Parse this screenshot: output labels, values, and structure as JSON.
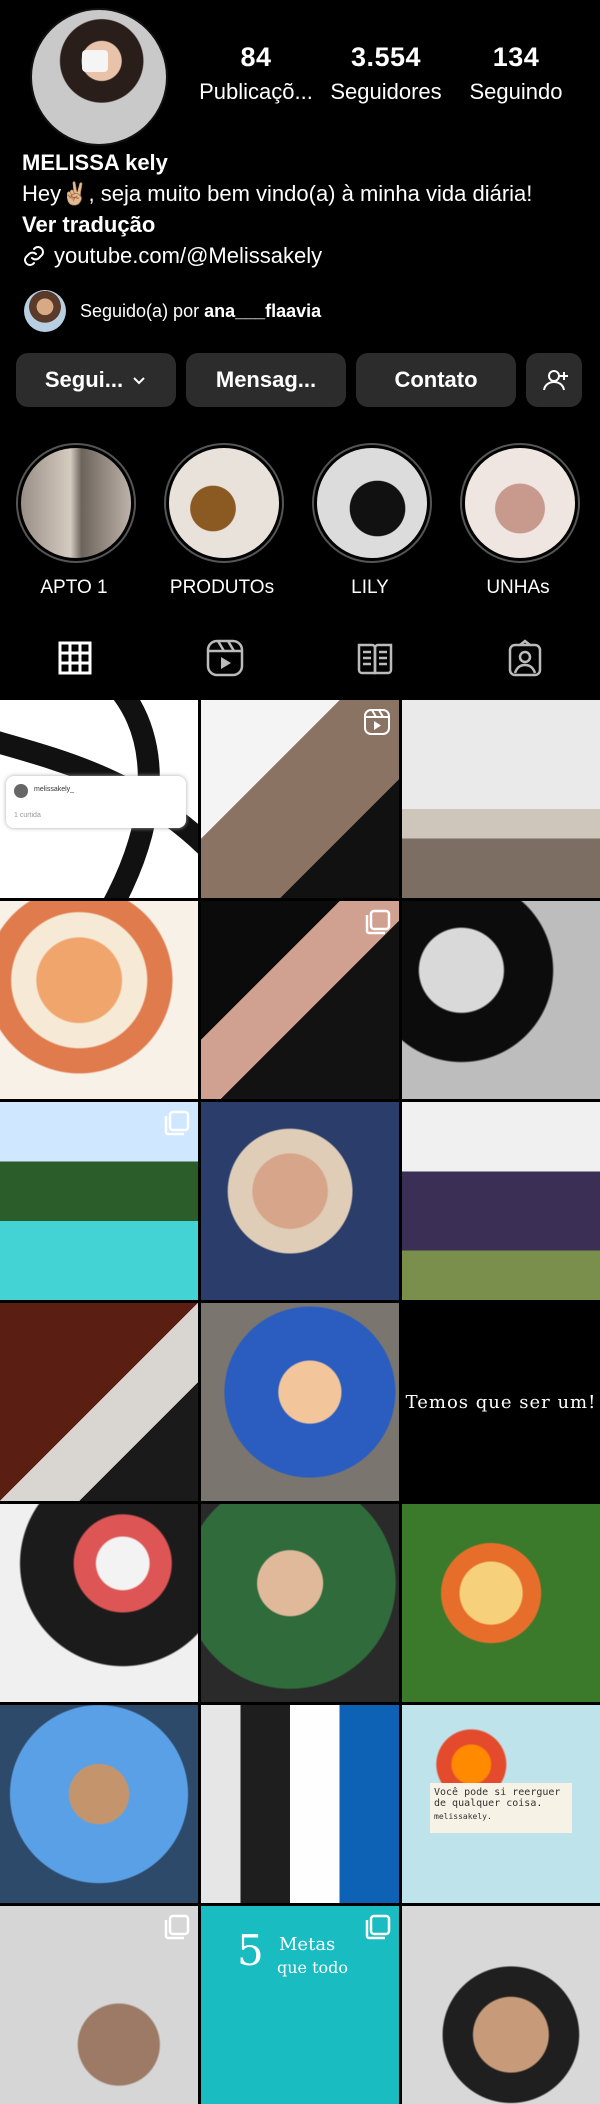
{
  "profile": {
    "username": "MELISSA kely",
    "bio": "Hey✌🏼, seja muito bem vindo(a) à minha vida diária!",
    "translate": "Ver tradução",
    "link": "youtube.com/@Melissakely",
    "followed_by_prefix": "Seguido(a) por ",
    "followed_by_user": "ana___flaavia"
  },
  "stats": [
    {
      "num": "84",
      "label": "Publicaçõ..."
    },
    {
      "num": "3.554",
      "label": "Seguidores"
    },
    {
      "num": "134",
      "label": "Seguindo"
    }
  ],
  "buttons": {
    "following": "Segui...",
    "message": "Mensag...",
    "contact": "Contato"
  },
  "highlights": [
    {
      "label": "APTO 1"
    },
    {
      "label": "PRODUTOs"
    },
    {
      "label": "LILY"
    },
    {
      "label": "UNHAs"
    }
  ],
  "tabs": [
    "grid-icon",
    "reels-icon",
    "guides-icon",
    "tagged-icon"
  ],
  "posts": {
    "threads_user": "melissakely_",
    "threads_reply": "1 curtida",
    "black_post_text": "Temos que ser um!",
    "quote_text": "Você pode si reerguer de qualquer coisa.",
    "quote_handle": "melissakely.",
    "metas_number": "5",
    "metas_text": "Metas",
    "metas_sub": "que todo"
  },
  "colors": {
    "background": "#000000",
    "button": "#2c2c2c",
    "text": "#ffffff"
  }
}
